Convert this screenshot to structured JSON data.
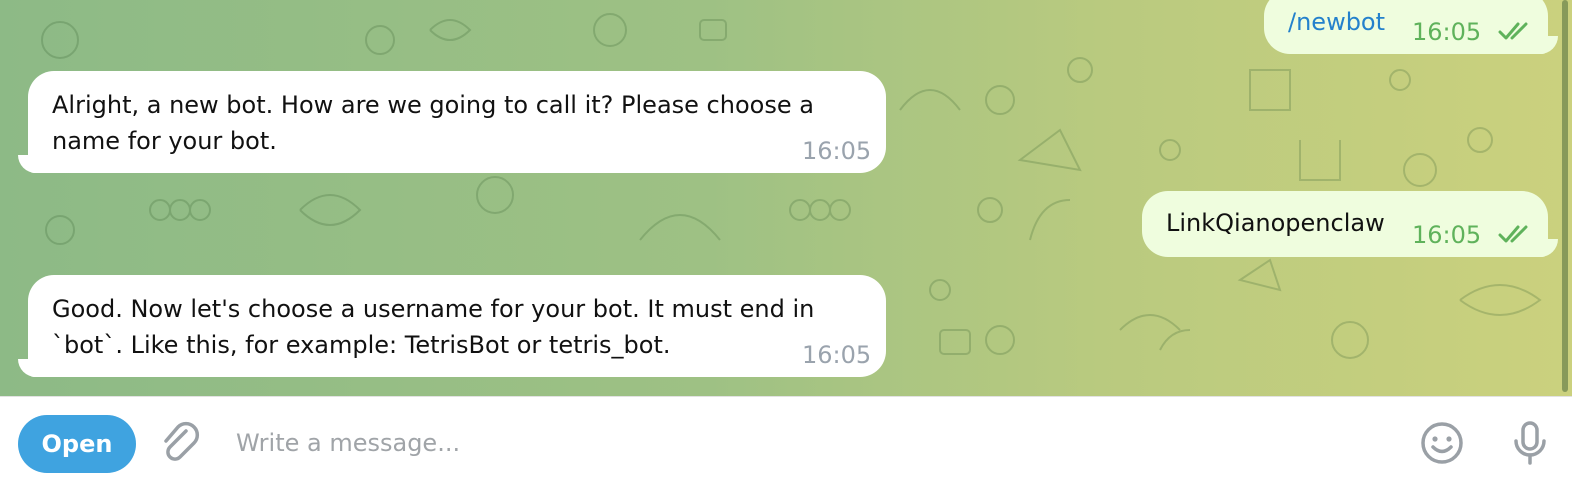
{
  "chat": {
    "messages": [
      {
        "direction": "out",
        "text": "/newbot",
        "time": "16:05",
        "status": "double-check-icon"
      },
      {
        "direction": "in",
        "lines": [
          "Alright, a new bot. How are we going to call it? Please choose a",
          "name for your bot."
        ],
        "time": "16:05"
      },
      {
        "direction": "out",
        "text": "LinkQianopenclaw",
        "time": "16:05",
        "status": "double-check-icon"
      },
      {
        "direction": "in",
        "lines": [
          "Good. Now let's choose a username for your bot. It must end in",
          "`bot`. Like this, for example: TetrisBot or tetris_bot."
        ],
        "time": "16:05"
      }
    ]
  },
  "composer": {
    "open_button_label": "Open",
    "placeholder": "Write a message...",
    "icons": {
      "attach": "paperclip-icon",
      "emoji": "emoji-icon",
      "voice": "microphone-icon"
    }
  },
  "colors": {
    "incoming_bubble": "#ffffff",
    "outgoing_bubble": "#effdde",
    "timestamp_out": "#5fb25b",
    "timestamp_in": "#9aa3ad",
    "link": "#2481cc",
    "open_button": "#3fa3e0"
  }
}
